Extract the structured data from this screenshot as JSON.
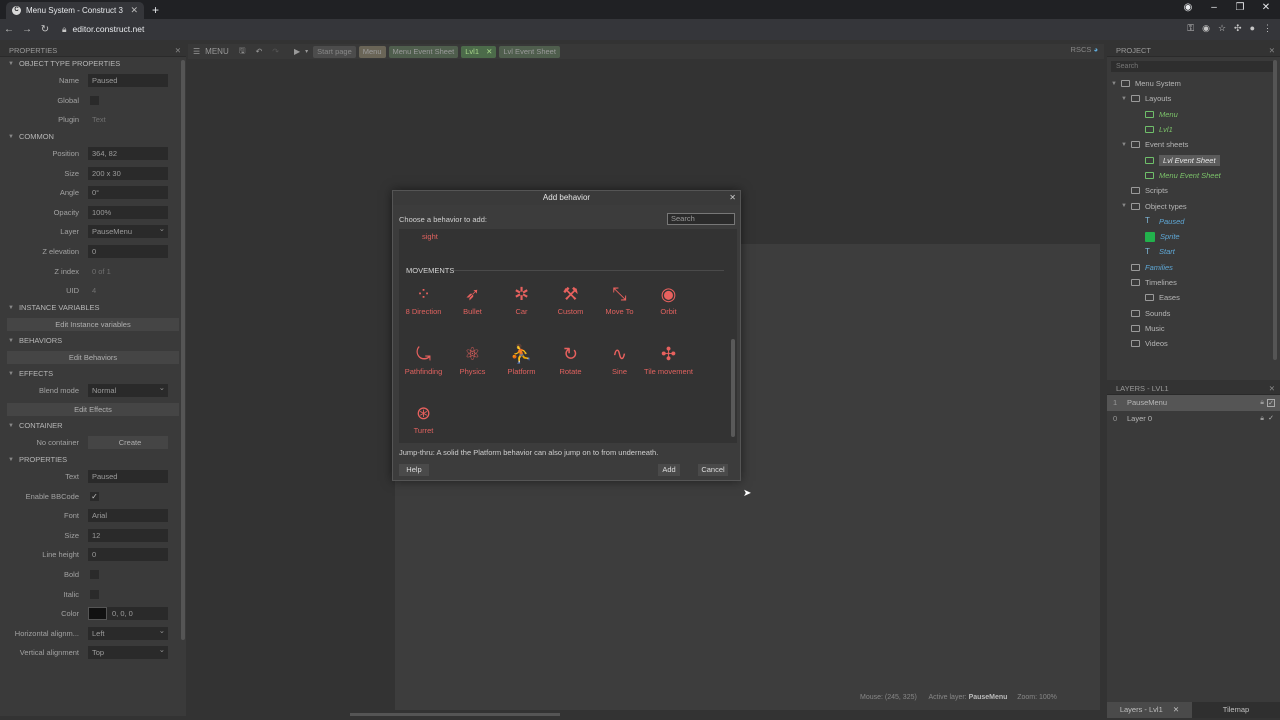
{
  "browser": {
    "tab_title": "Menu System - Construct 3",
    "url": "editor.construct.net",
    "new_tab": "+",
    "tab_close": "✕"
  },
  "toolbar": {
    "menu_label": "MENU",
    "tabs": [
      {
        "label": "Start page"
      },
      {
        "label": "Menu"
      },
      {
        "label": "Menu Event Sheet"
      },
      {
        "label": "Lvl1"
      },
      {
        "label": "Lvl Event Sheet"
      }
    ],
    "active_tab_close": "✕",
    "rscs": "RSCS"
  },
  "properties": {
    "panel_title": "PROPERTIES",
    "sections": {
      "object_type": "OBJECT TYPE PROPERTIES",
      "common": "COMMON",
      "instance_variables": "INSTANCE VARIABLES",
      "behaviors": "BEHAVIORS",
      "effects": "EFFECTS",
      "container": "CONTAINER",
      "properties": "PROPERTIES"
    },
    "name": {
      "label": "Name",
      "value": "Paused"
    },
    "global": {
      "label": "Global"
    },
    "plugin": {
      "label": "Plugin",
      "value": "Text"
    },
    "position": {
      "label": "Position",
      "value": "364, 82"
    },
    "size": {
      "label": "Size",
      "value": "200 x 30"
    },
    "angle": {
      "label": "Angle",
      "value": "0°"
    },
    "opacity": {
      "label": "Opacity",
      "value": "100%"
    },
    "layer": {
      "label": "Layer",
      "value": "PauseMenu"
    },
    "z_elevation": {
      "label": "Z elevation",
      "value": "0"
    },
    "z_index": {
      "label": "Z index",
      "value": "0 of 1"
    },
    "uid": {
      "label": "UID",
      "value": "4"
    },
    "edit_instance_variables": "Edit Instance variables",
    "edit_behaviors": "Edit Behaviors",
    "blend_mode": {
      "label": "Blend mode",
      "value": "Normal"
    },
    "edit_effects": "Edit Effects",
    "no_container": {
      "label": "No container",
      "button": "Create"
    },
    "text": {
      "label": "Text",
      "value": "Paused"
    },
    "enable_bbcode": {
      "label": "Enable BBCode",
      "value": "✓"
    },
    "font": {
      "label": "Font",
      "value": "Arial"
    },
    "font_size": {
      "label": "Size",
      "value": "12"
    },
    "line_height": {
      "label": "Line height",
      "value": "0"
    },
    "bold": {
      "label": "Bold"
    },
    "italic": {
      "label": "Italic"
    },
    "color": {
      "label": "Color",
      "value": "0, 0, 0",
      "swatch": "#111111"
    },
    "h_align": {
      "label": "Horizontal alignm...",
      "value": "Left"
    },
    "v_align": {
      "label": "Vertical alignment",
      "value": "Top"
    }
  },
  "dialog": {
    "title": "Add behavior",
    "close": "✕",
    "prompt": "Choose a behavior to add:",
    "search_placeholder": "Search",
    "partial_item": "sight",
    "category": "MOVEMENTS",
    "behaviors": [
      {
        "label": "8 Direction",
        "icon": "eight-direction-icon",
        "glyph": "⁘"
      },
      {
        "label": "Bullet",
        "icon": "bullet-icon",
        "glyph": "➶"
      },
      {
        "label": "Car",
        "icon": "car-icon",
        "glyph": "✲"
      },
      {
        "label": "Custom",
        "icon": "wrench-icon",
        "glyph": "⚒"
      },
      {
        "label": "Move To",
        "icon": "move-to-icon",
        "glyph": "⤡"
      },
      {
        "label": "Orbit",
        "icon": "orbit-icon",
        "glyph": "◉"
      },
      {
        "label": "Pathfinding",
        "icon": "pathfinding-icon",
        "glyph": "⤿"
      },
      {
        "label": "Physics",
        "icon": "physics-icon",
        "glyph": "⚛"
      },
      {
        "label": "Platform",
        "icon": "platform-icon",
        "glyph": "⛹"
      },
      {
        "label": "Rotate",
        "icon": "rotate-icon",
        "glyph": "↻"
      },
      {
        "label": "Sine",
        "icon": "sine-icon",
        "glyph": "∿"
      },
      {
        "label": "Tile movement",
        "icon": "tile-movement-icon",
        "glyph": "✣"
      },
      {
        "label": "Turret",
        "icon": "turret-icon",
        "glyph": "⊛"
      }
    ],
    "description": "Jump-thru: A solid the Platform behavior can also jump on to from underneath.",
    "help": "Help",
    "add": "Add",
    "cancel": "Cancel"
  },
  "status": {
    "mouse": "Mouse: (245, 325)",
    "active_layer_label": "Active layer:",
    "active_layer": "PauseMenu",
    "zoom": "Zoom: 100%"
  },
  "project": {
    "panel_title": "PROJECT",
    "search_placeholder": "Search",
    "tree": {
      "root": "Menu System",
      "layouts": "Layouts",
      "layout_items": [
        "Menu",
        "Lvl1"
      ],
      "event_sheets": "Event sheets",
      "event_items": [
        "Lvl Event Sheet",
        "Menu Event Sheet"
      ],
      "scripts": "Scripts",
      "object_types": "Object types",
      "object_items": [
        "Paused",
        "Sprite",
        "Start"
      ],
      "families": "Families",
      "timelines": "Timelines",
      "eases": "Eases",
      "sounds": "Sounds",
      "music": "Music",
      "videos": "Videos"
    }
  },
  "layers": {
    "panel_title": "LAYERS - LVL1",
    "rows": [
      {
        "index": "1",
        "name": "PauseMenu"
      },
      {
        "index": "0",
        "name": "Layer 0"
      }
    ]
  },
  "bottom_tabs": {
    "layers": "Layers - Lvl1",
    "tilemap": "Tilemap",
    "close": "✕"
  }
}
